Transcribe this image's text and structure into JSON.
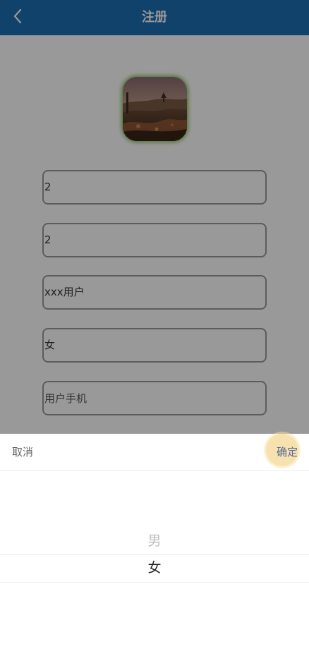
{
  "header": {
    "title": "注册",
    "back_icon": "chevron-left-icon",
    "background_color": "#1d6fb5"
  },
  "form": {
    "avatar_icon": "avatar-landscape-image",
    "fields": [
      {
        "value": "2",
        "placeholder": ""
      },
      {
        "value": "2",
        "placeholder": ""
      },
      {
        "value": "xxx用户",
        "placeholder": ""
      },
      {
        "value": "女",
        "placeholder": ""
      },
      {
        "value": "",
        "placeholder": "用户手机"
      }
    ]
  },
  "picker": {
    "cancel_label": "取消",
    "confirm_label": "确定",
    "options": [
      "男",
      "女"
    ],
    "selected": "女"
  }
}
